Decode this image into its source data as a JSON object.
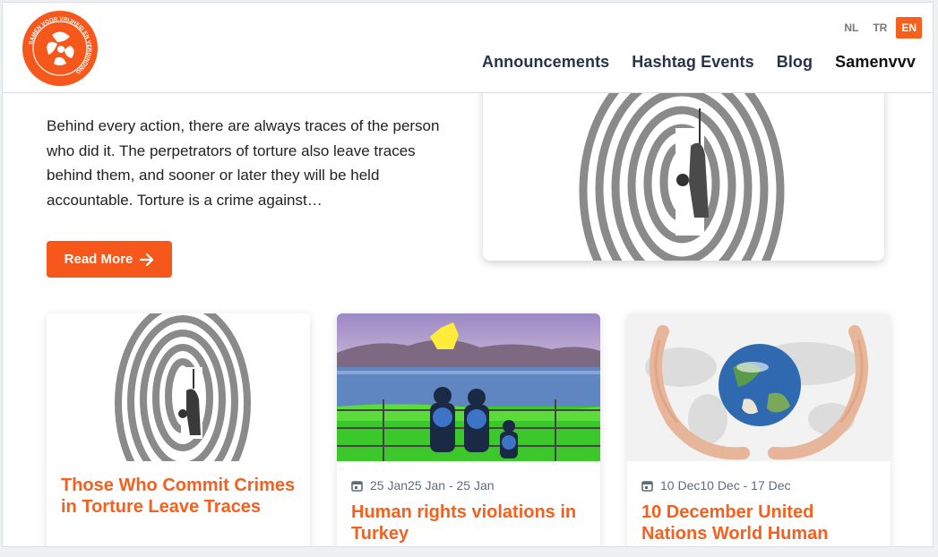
{
  "header": {
    "languages": [
      {
        "code": "NL",
        "active": false
      },
      {
        "code": "TR",
        "active": false
      },
      {
        "code": "EN",
        "active": true
      }
    ],
    "nav": [
      "Announcements",
      "Hashtag Events",
      "Blog",
      "Samenvvv"
    ],
    "logo_text": "SAMEN VOOR VRIJHEID EN VERBINDING"
  },
  "hero": {
    "text": "Behind every action, there are always traces of the person who did it. The perpetrators of torture also leave traces behind them, and sooner or later they will be held accountable. Torture is a crime against…",
    "button_label": "Read More"
  },
  "cards": [
    {
      "title": "Those Who Commit Crimes in Torture Leave Traces",
      "date": ""
    },
    {
      "title": "Human rights violations in Turkey",
      "date": "25 Jan25 Jan - 25 Jan"
    },
    {
      "title": "10 December United Nations World Human",
      "date": "10 Dec10 Dec - 17 Dec"
    }
  ],
  "colors": {
    "accent": "#f5601e",
    "nav_text": "#26344a"
  }
}
